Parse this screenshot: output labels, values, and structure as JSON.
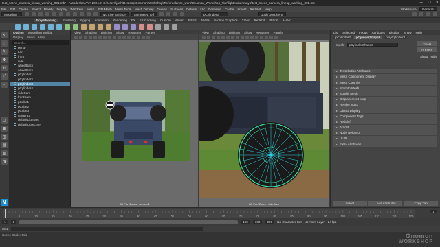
{
  "titlebar": {
    "title": "test_scene_camera_lineup_working_001.mb* - Autodesk MAYA 2024.2: C:\\Users\\josh\\Desktop\\Gnomon\\Workshop\\Tire\\freelance_work\\Gnomon_Workshop_Tire\\lightMaker\\maya\\test_scene_camera_lineup_working_001.mb",
    "minimize": "—",
    "maximize": "☐",
    "close": "✕"
  },
  "menubar": {
    "items": [
      "File",
      "Edit",
      "Create",
      "Select",
      "Modify",
      "Display",
      "Windows",
      "Mesh",
      "Edit Mesh",
      "Mesh Tools",
      "Mesh Display",
      "Curves",
      "Surfaces",
      "Deform",
      "UV",
      "Generate",
      "Cache",
      "Arnold",
      "Redshift",
      "Help"
    ],
    "workspace_label": "Workspace:",
    "workspace_value": "General*"
  },
  "statusline": {
    "mode": "Modeling",
    "no_live_surface": "No Live Surface",
    "symmetry": "Symmetry: Off",
    "object_field": "pCylinder3",
    "user": "Josh Dougherty"
  },
  "shelftabs": [
    "Poly Modeling",
    "Sculpting",
    "Rigging",
    "Animation",
    "Rendering",
    "FX",
    "FX Caching",
    "Custom",
    "Arnold",
    "Bifrost",
    "MASH",
    "Motion Graphics",
    "XGen",
    "Redshift",
    "Bifrost",
    "MAW"
  ],
  "shelftab_active_index": 0,
  "outliner": {
    "tabs": [
      "Outliner",
      "Modelling Toolkit"
    ],
    "menu": [
      "Display",
      "Show",
      "Help"
    ],
    "search_placeholder": "Search...",
    "items": [
      {
        "label": "persp",
        "selected": false
      },
      {
        "label": "top",
        "selected": false
      },
      {
        "label": "front",
        "selected": false
      },
      {
        "label": "side",
        "selected": false
      },
      {
        "label": "wheelBack",
        "selected": false
      },
      {
        "label": "wheelBack",
        "selected": false
      },
      {
        "label": "pCylinder1",
        "selected": false
      },
      {
        "label": "pCylinder2",
        "selected": false
      },
      {
        "label": "pCylinder3",
        "selected": true
      },
      {
        "label": "pCylinder4",
        "selected": false
      },
      {
        "label": "sideCam",
        "selected": false
      },
      {
        "label": "frontCam",
        "selected": false
      },
      {
        "label": "pCube1",
        "selected": false
      },
      {
        "label": "pCube2",
        "selected": false
      },
      {
        "label": "pCube3",
        "selected": false
      },
      {
        "label": "camera1",
        "selected": false
      },
      {
        "label": "defaultLightSet",
        "selected": false
      },
      {
        "label": "defaultObjectSet",
        "selected": false
      }
    ]
  },
  "viewport_left": {
    "menu": [
      "View",
      "Shading",
      "Lighting",
      "Show",
      "Renderer",
      "Panels"
    ],
    "camera_label": "2D Pan/Zoom : camera1"
  },
  "viewport_right": {
    "menu": [
      "View",
      "Shading",
      "Lighting",
      "Show",
      "Renderer",
      "Panels"
    ],
    "camera_label": "2D Pan/Zoom : sideCam"
  },
  "attribute_editor": {
    "tabs": [
      "List",
      "Selected",
      "Focus",
      "Attributes",
      "Display",
      "Show",
      "Help"
    ],
    "node_tabs": [
      "pCylinder3",
      "pCylinderShape3",
      "polyCylinder3"
    ],
    "node_tab_active_index": 1,
    "field_label": "mesh:",
    "field_value": "pCylinderShape3",
    "focus_button": "Focus",
    "presets_button": "Presets",
    "show_button": "Show",
    "hide_button": "Hide",
    "sections": [
      "Tessellation Attributes",
      "Mesh Component Display",
      "Mesh Controls",
      "Smooth Mesh",
      "Subdiv Mesh",
      "Displacement Map",
      "Render Stats",
      "Object Display",
      "Component Tags",
      "Redshift",
      "Arnold",
      "Node Behavior",
      "UUID",
      "Extra Attributes"
    ],
    "bottom_buttons": [
      "Select",
      "Load Attributes",
      "Copy Tab"
    ]
  },
  "timeslider": {
    "ticks": [
      "5",
      "10",
      "15",
      "20",
      "25",
      "30",
      "35",
      "40",
      "45",
      "50",
      "55",
      "60",
      "65",
      "70",
      "75",
      "80",
      "85",
      "90",
      "95",
      "100",
      "105",
      "110",
      "115",
      "120"
    ],
    "current_frame": "1"
  },
  "rangeslider": {
    "start": "1",
    "start_inner": "1",
    "end_inner": "100",
    "end": "100",
    "anim_end": "200",
    "fps": "24 fps",
    "no_character_set": "No Character Set",
    "no_anim_layer": "No Anim Layer"
  },
  "cmdline": {
    "lang": "MEL"
  },
  "helpline": {
    "text": "Scene Scale: Grid",
    "watermark_line1": "Gnomon",
    "watermark_line2": "WORKSHOP"
  },
  "colors": {
    "selection": "#5285a6",
    "accent_blue": "#1b8fd0",
    "wheel_wire": "#3fe0a0"
  }
}
